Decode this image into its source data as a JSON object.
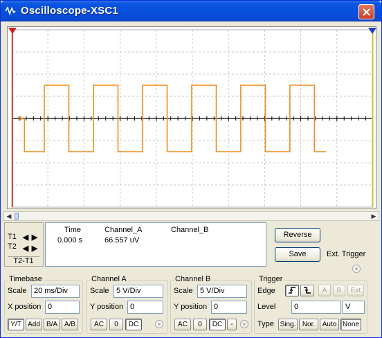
{
  "window": {
    "title": "Oscilloscope-XSC1"
  },
  "readout": {
    "headers": {
      "time": "Time",
      "channel_a": "Channel_A",
      "channel_b": "Channel_B"
    },
    "row": {
      "time": "0.000 s",
      "channel_a": "66.557 uV",
      "channel_b": ""
    }
  },
  "cursors": {
    "t1": "T1",
    "t2": "T2",
    "diff": "T2-T1"
  },
  "buttons": {
    "reverse": "Reverse",
    "save": "Save",
    "ext_trigger": "Ext. Trigger"
  },
  "timebase": {
    "title": "Timebase",
    "scale_label": "Scale",
    "scale_value": "20 ms/Div",
    "xpos_label": "X position",
    "xpos_value": "0",
    "modes": [
      "Y/T",
      "Add",
      "B/A",
      "A/B"
    ],
    "active_mode": "Y/T"
  },
  "channel_a": {
    "title": "Channel A",
    "scale_label": "Scale",
    "scale_value": "5  V/Div",
    "ypos_label": "Y position",
    "ypos_value": "0",
    "coupling": [
      "AC",
      "0",
      "DC"
    ],
    "active_coupling": "DC"
  },
  "channel_b": {
    "title": "Channel B",
    "scale_label": "Scale",
    "scale_value": "5  V/Div",
    "ypos_label": "Y position",
    "ypos_value": "0",
    "coupling": [
      "AC",
      "0",
      "DC",
      "-"
    ],
    "active_coupling": "DC"
  },
  "trigger": {
    "title": "Trigger",
    "edge_label": "Edge",
    "edge_sources": [
      "A",
      "B",
      "Ext"
    ],
    "level_label": "Level",
    "level_value": "0",
    "level_unit": "V",
    "type_label": "Type",
    "types": [
      "Sing.",
      "Nor.",
      "Auto",
      "None"
    ],
    "active_type": "None"
  },
  "colors": {
    "trace": "#f08c1e",
    "grid": "#c8c8c8",
    "axis": "#000000",
    "title_bar": "#0650dd"
  },
  "chart_data": {
    "type": "line",
    "x_unit": "div",
    "y_unit": "V",
    "xlim": [
      0,
      10
    ],
    "ylim": [
      -20,
      20
    ],
    "series": [
      {
        "x": [
          0.35,
          0.35,
          0.9,
          0.9,
          1.58,
          1.58,
          2.26,
          2.26,
          2.94,
          2.94,
          3.62,
          3.62,
          4.3,
          4.3,
          4.98,
          4.98,
          5.66,
          5.66,
          6.34,
          6.34,
          7.02,
          7.02,
          7.7,
          7.7,
          8.38,
          8.38,
          8.7
        ],
        "y": [
          0,
          -7.5,
          -7.5,
          7.5,
          7.5,
          -7.5,
          -7.5,
          7.5,
          7.5,
          -7.5,
          -7.5,
          7.5,
          7.5,
          -7.5,
          -7.5,
          7.5,
          7.5,
          -7.5,
          -7.5,
          7.5,
          7.5,
          -7.5,
          -7.5,
          7.5,
          7.5,
          -7.5,
          -7.5
        ]
      }
    ]
  }
}
